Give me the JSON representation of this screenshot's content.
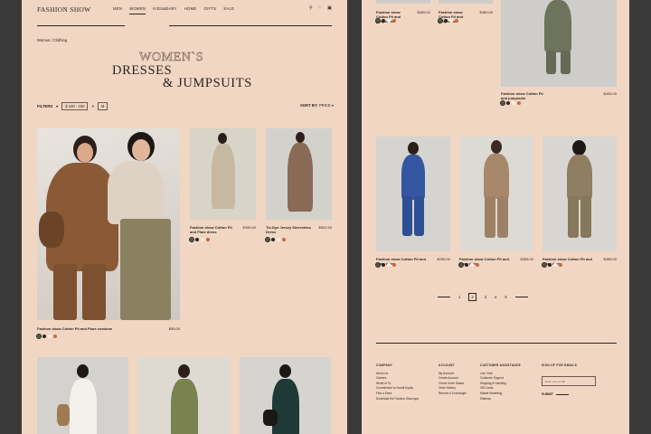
{
  "header": {
    "logo": "FASHION SHOW",
    "nav": [
      "MEN",
      "WOMEN",
      "KIDS&BABY",
      "HOME",
      "GIFTS",
      "SALE"
    ],
    "active_nav": "WOMEN",
    "icons": [
      "search-icon",
      "heart-icon",
      "cart-icon"
    ]
  },
  "breadcrumb": "Women / Clothing",
  "title": {
    "line1": "WOMEN`S",
    "line2": "DRESSES",
    "line3": "& JUMPSUITS"
  },
  "filters": {
    "label": "FILTERS",
    "price_range": "$ 100 - 150",
    "size": "M"
  },
  "sort": {
    "label": "SORT BY:",
    "value": "PRICE"
  },
  "left_products": [
    {
      "name": "Fashion show  Cotton Fit and Flare costume",
      "price": "$55.00",
      "swatches": [
        "#4a5a46",
        "#2b2420",
        "#f5f0ea",
        "#c86a3a"
      ]
    },
    {
      "name": "Fashion show  Cotton Fit and Flare dress",
      "price": "$399.00",
      "swatches": [
        "#4a5a46",
        "#2b2420",
        "#f5f0ea",
        "#c86a3a"
      ]
    },
    {
      "name": "Tie-Dye Jersey Sleeveless Dress",
      "price": "$520.50",
      "swatches": [
        "#4a5a46",
        "#2b2420",
        "#f5f0ea",
        "#c86a3a"
      ]
    }
  ],
  "right_top_products": [
    {
      "name": "Fashion show  Cotton Fit and jumpsuits",
      "price": "$355.00",
      "swatches": [
        "#4a5a46",
        "#2b2420",
        "#f5f0ea",
        "#c86a3a"
      ]
    },
    {
      "name": "Fashion show  Cotton Fit and jumpsuits",
      "price": "$380.00",
      "swatches": [
        "#4a5a46",
        "#2b2420",
        "#f5f0ea",
        "#c86a3a"
      ]
    },
    {
      "name": "Fashion show  Cotton Fit and jumpsuits",
      "price": "$405.00",
      "swatches": [
        "#4a5a46",
        "#2b2420",
        "#f5f0ea",
        "#c86a3a"
      ]
    }
  ],
  "right_products": [
    {
      "name": "Fashion show  Cotton Fit and Flare dress",
      "price": "$255.00",
      "swatches": [
        "#4a5a46",
        "#2b2420",
        "#f5f0ea",
        "#c86a3a"
      ]
    },
    {
      "name": "Fashion show  Cotton Fit and Flare dress",
      "price": "$355.00",
      "swatches": [
        "#4a5a46",
        "#2b2420",
        "#f5f0ea",
        "#c86a3a"
      ]
    },
    {
      "name": "Fashion show  Cotton Fit and Flare dress",
      "price": "$355.00",
      "swatches": [
        "#4a5a46",
        "#2b2420",
        "#f5f0ea",
        "#c86a3a"
      ]
    }
  ],
  "pagination": {
    "pages": [
      "1",
      "2",
      "3",
      "4",
      "5"
    ],
    "current": "2"
  },
  "footer": {
    "company": {
      "heading": "COMPANY",
      "items": [
        "About Us",
        "Careers",
        "World of XL",
        "Commitment to Social Equity",
        "Find a Store",
        "Download the Fashion Show app"
      ]
    },
    "account": {
      "heading": "ACCOUNT",
      "items": [
        "My Account",
        "Create Account",
        "Check Order Status",
        "Order History",
        "Returns & Exchanges"
      ]
    },
    "customer": {
      "heading": "CUSTOMER ASSISTANCE",
      "items": [
        "Live Chat",
        "Customer Support",
        "Shipping & Handling",
        "Gift Cards",
        "Mobile Marketing",
        "Sitemap"
      ]
    },
    "signup": {
      "heading": "SIGN UP FOR EMAILS",
      "placeholder": "Enter your email",
      "submit": "SUBMIT"
    }
  },
  "colors": {
    "panel": "#f1d6c3",
    "background": "#3b3a3a",
    "text": "#2b2420"
  }
}
